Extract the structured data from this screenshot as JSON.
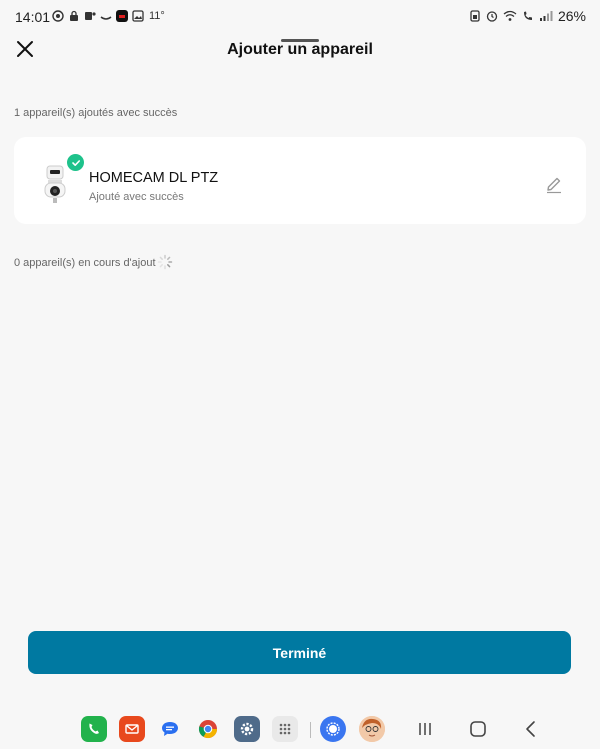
{
  "status_bar": {
    "time": "14:01",
    "temperature": "11°",
    "battery": "26%"
  },
  "header": {
    "title": "Ajouter un appareil"
  },
  "added_section": {
    "label": "1 appareil(s) ajoutés avec succès"
  },
  "device": {
    "name": "HOMECAM DL PTZ",
    "status": "Ajouté avec succès"
  },
  "pending_section": {
    "label": "0 appareil(s) en cours d'ajout"
  },
  "done_button": {
    "label": "Terminé"
  },
  "colors": {
    "accent": "#0079a1",
    "success": "#1ec28b"
  },
  "dock": {
    "apps": [
      "phone-icon",
      "email-icon",
      "messages-icon",
      "chrome-icon",
      "settings-icon",
      "app-drawer-icon",
      "signal-icon",
      "avatar-app-icon"
    ],
    "nav": [
      "recents-icon",
      "home-icon",
      "back-icon"
    ]
  }
}
